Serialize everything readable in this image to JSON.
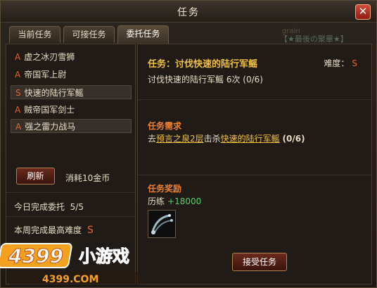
{
  "window": {
    "title": "任务",
    "close_label": "✕"
  },
  "tabs": [
    {
      "label": "当前任务"
    },
    {
      "label": "可接任务"
    },
    {
      "label": "委托任务",
      "active": true
    }
  ],
  "watermark": {
    "faint_text": "grain",
    "link_text": "【★最後の聚華★】"
  },
  "quest_list": [
    {
      "grade": "A",
      "name": "虚之冰刃雪狮"
    },
    {
      "grade": "A",
      "name": "帝国军上尉"
    },
    {
      "grade": "S",
      "name": "快速的陆行军鳐",
      "selected": true
    },
    {
      "grade": "A",
      "name": "贼帝国军剑士"
    },
    {
      "grade": "A",
      "name": "强之雷力战马",
      "selected": true
    }
  ],
  "refresh": {
    "button_label": "刷新",
    "cost_text": "消耗10金币"
  },
  "stats": {
    "today_label": "今日完成委托",
    "today_value": "5/5",
    "week_label": "本周完成最高难度",
    "week_value": "S"
  },
  "detail": {
    "title": "任务：讨伐快速的陆行军鳐",
    "difficulty_label": "难度：",
    "difficulty_value": "S",
    "summary": "讨伐快速的陆行军鳐 6次 (0/6)",
    "requirement": {
      "heading": "任务需求",
      "prefix": "去",
      "location": "预言之泉2层",
      "middle": "击杀",
      "target": "快速的陆行军鳐",
      "progress": "(0/6)"
    },
    "reward": {
      "heading": "任务奖励",
      "exp_label": "历练",
      "exp_value": "+18000",
      "item_icon": "chain-whip-icon"
    },
    "accept_label": "接受任务"
  },
  "logo": {
    "number": "4399",
    "text": "小游戏",
    "url_text": "4399.COM"
  },
  "colors": {
    "grade": "#e8622c",
    "title_gold": "#f0c040",
    "heading_orange": "#f08030",
    "exp_green": "#58d068"
  }
}
